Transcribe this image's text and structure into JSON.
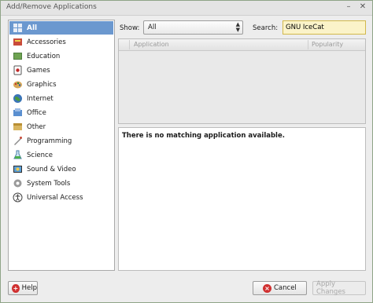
{
  "window": {
    "title": "Add/Remove Applications"
  },
  "sidebar": {
    "items": [
      {
        "label": "All",
        "icon": "all-icon"
      },
      {
        "label": "Accessories",
        "icon": "accessories-icon"
      },
      {
        "label": "Education",
        "icon": "education-icon"
      },
      {
        "label": "Games",
        "icon": "games-icon"
      },
      {
        "label": "Graphics",
        "icon": "graphics-icon"
      },
      {
        "label": "Internet",
        "icon": "internet-icon"
      },
      {
        "label": "Office",
        "icon": "office-icon"
      },
      {
        "label": "Other",
        "icon": "other-icon"
      },
      {
        "label": "Programming",
        "icon": "programming-icon"
      },
      {
        "label": "Science",
        "icon": "science-icon"
      },
      {
        "label": "Sound & Video",
        "icon": "sound-video-icon"
      },
      {
        "label": "System Tools",
        "icon": "system-tools-icon"
      },
      {
        "label": "Universal Access",
        "icon": "universal-access-icon"
      }
    ]
  },
  "filter": {
    "show_label": "Show:",
    "show_value": "All",
    "search_label": "Search:",
    "search_value": "GNU IceCat"
  },
  "table": {
    "columns": [
      "Application",
      "Popularity"
    ]
  },
  "description": {
    "message": "There is no matching application available."
  },
  "buttons": {
    "help": "Help",
    "cancel": "Cancel",
    "apply": "Apply Changes"
  },
  "colors": {
    "selection": "#6b98cf",
    "search_bg": "#fbf3c9"
  }
}
